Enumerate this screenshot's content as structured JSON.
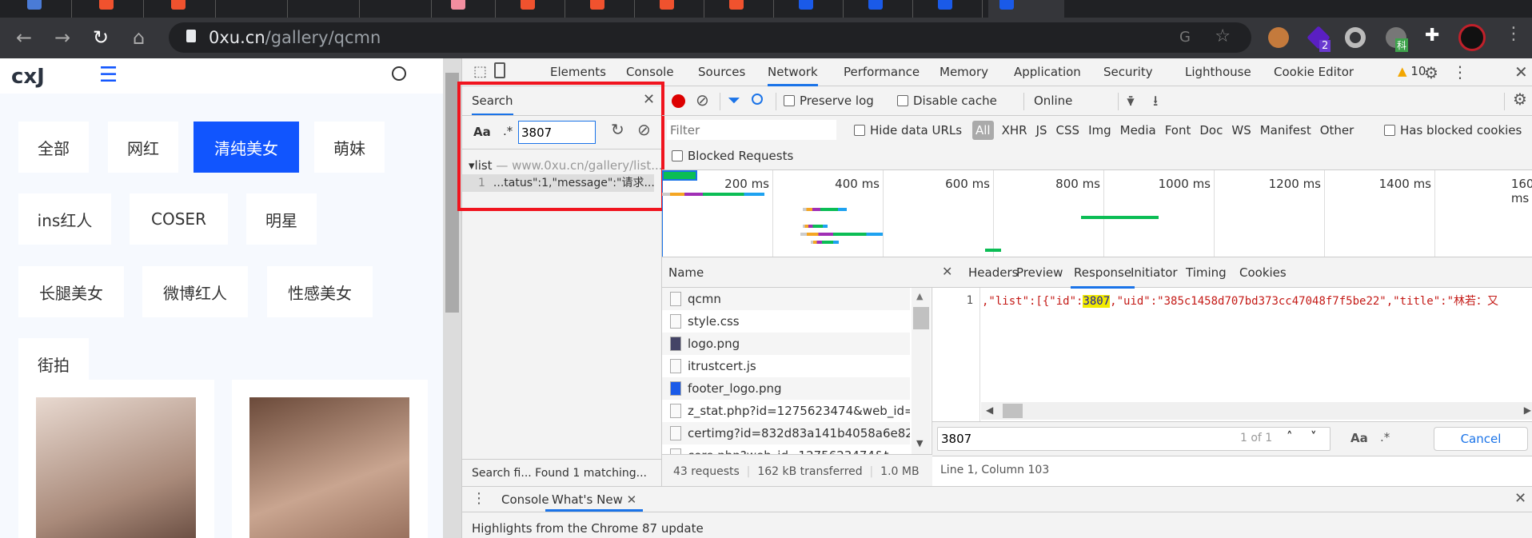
{
  "browser": {
    "url_host": "0xu.cn",
    "url_path": "/gallery/qcmn",
    "extension_badge": "2",
    "extension_label": "科"
  },
  "page": {
    "categories": [
      {
        "label": "全部",
        "active": false
      },
      {
        "label": "网红",
        "active": false
      },
      {
        "label": "清纯美女",
        "active": true
      },
      {
        "label": "萌妹",
        "active": false
      },
      {
        "label": "ins红人",
        "active": false
      },
      {
        "label": "COSER",
        "active": false
      },
      {
        "label": "明星",
        "active": false
      },
      {
        "label": "长腿美女",
        "active": false
      },
      {
        "label": "微博红人",
        "active": false
      },
      {
        "label": "性感美女",
        "active": false
      },
      {
        "label": "街拍",
        "active": false
      }
    ],
    "accent": "#1155fe"
  },
  "devtools": {
    "tabs": [
      "Elements",
      "Console",
      "Sources",
      "Network",
      "Performance",
      "Memory",
      "Application",
      "Security",
      "Lighthouse",
      "Cookie Editor"
    ],
    "active_tab": "Network",
    "warning_count": "10",
    "search": {
      "title": "Search",
      "case_label": "Aa",
      "regex_label": ".*",
      "query": "3807",
      "result_file": "list",
      "result_url": "— www.0xu.cn/gallery/list...",
      "result_line": "1",
      "result_text": "...tatus\":1,\"message\":\"请求...",
      "status": "Search fi...  Found 1 matching..."
    },
    "network": {
      "preserve_log": "Preserve log",
      "disable_cache": "Disable cache",
      "throttling": "Online",
      "filter_placeholder": "Filter",
      "hide_data_urls": "Hide data URLs",
      "type_filters": [
        "All",
        "XHR",
        "JS",
        "CSS",
        "Img",
        "Media",
        "Font",
        "Doc",
        "WS",
        "Manifest",
        "Other"
      ],
      "has_blocked_cookies": "Has blocked cookies",
      "blocked_requests": "Blocked Requests",
      "timeline_ticks": [
        "200 ms",
        "400 ms",
        "600 ms",
        "800 ms",
        "1000 ms",
        "1200 ms",
        "1400 ms",
        "1600 ms"
      ],
      "waterfall_ms": [
        [
          0,
          185
        ],
        [
          255,
          335
        ],
        [
          760,
          900
        ],
        [
          255,
          300
        ],
        [
          250,
          400
        ],
        [
          270,
          320
        ],
        [
          585,
          615
        ],
        [
          500,
          910
        ],
        [
          500,
          930
        ],
        [
          500,
          860
        ],
        [
          500,
          970
        ],
        [
          500,
          960
        ],
        [
          500,
          860
        ],
        [
          1060,
          1160
        ]
      ],
      "name_header": "Name",
      "requests": [
        "qcmn",
        "style.css",
        "logo.png",
        "itrustcert.js",
        "footer_logo.png",
        "z_stat.php?id=1275623474&web_id=12",
        "certimg?id=832d83a141b4058a6e82bc",
        "core.php?web_id=1275623474&t=..."
      ],
      "summary": {
        "requests": "43 requests",
        "transferred": "162 kB transferred",
        "resources": "1.0 MB"
      },
      "detail_tabs": [
        "Headers",
        "Preview",
        "Response",
        "Initiator",
        "Timing",
        "Cookies"
      ],
      "active_detail_tab": "Response",
      "response_line_no": "1",
      "response_pre": ",\"list\":[{\"id\":",
      "response_match": "3807",
      "response_post": ",\"uid\":\"385c1458d707bd373cc47048f7f5be22\",\"title\":\"林若：又",
      "find_query": "3807",
      "find_count": "1 of 1",
      "find_case": "Aa",
      "find_regex": ".*",
      "cancel": "Cancel",
      "cursor_pos": "Line 1, Column 103"
    },
    "drawer": {
      "tabs": [
        "Console",
        "What's New"
      ],
      "active_tab": "What's New",
      "content": "Highlights from the Chrome 87 update"
    }
  }
}
